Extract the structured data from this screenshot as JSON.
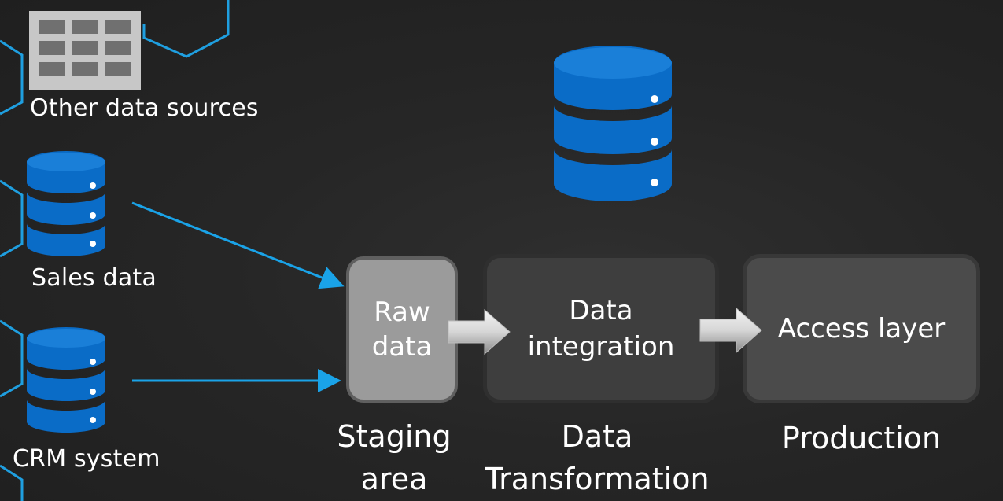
{
  "sources": [
    {
      "label": "Other data sources",
      "icon": "table-grid-icon"
    },
    {
      "label": "Sales data",
      "icon": "database-icon"
    },
    {
      "label": "CRM system",
      "icon": "database-icon"
    }
  ],
  "pipeline": {
    "raw": {
      "line1": "Raw",
      "line2": "data"
    },
    "integration": {
      "line1": "Data",
      "line2": "integration"
    },
    "access": {
      "line1": "Access layer"
    }
  },
  "stages": {
    "staging": {
      "line1": "Staging",
      "line2": "area"
    },
    "transformation": {
      "line1": "Data",
      "line2": "Transformation"
    },
    "production": {
      "line1": "Production"
    }
  },
  "colors": {
    "accent_blue": "#0a6cc7",
    "arrow_blue": "#1aa3e8",
    "hex_outline": "#1f9fe0"
  }
}
